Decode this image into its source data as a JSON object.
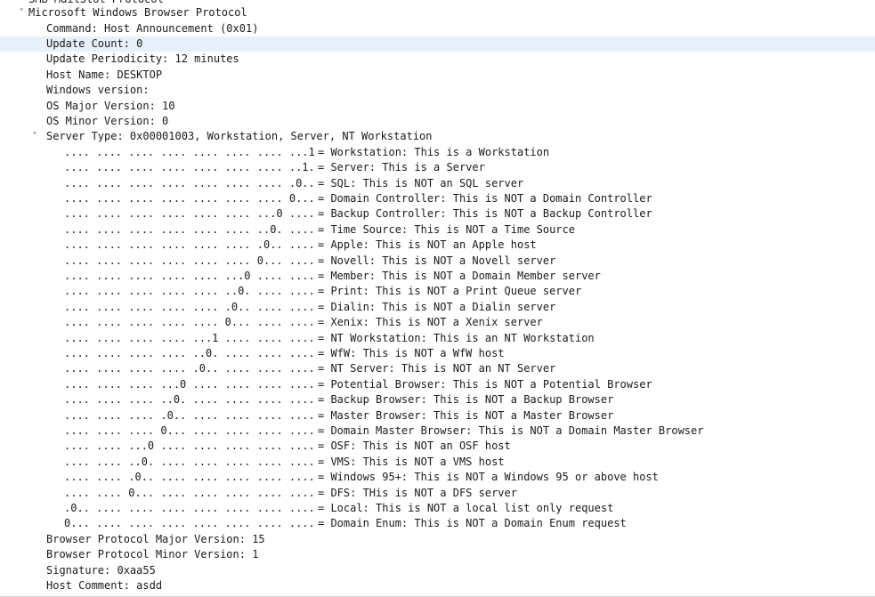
{
  "tree": {
    "cut_row": "SMB MailSlot Protocol",
    "protocol_label": "Microsoft Windows Browser Protocol",
    "toggle_glyph": "˅",
    "top_fields": [
      "Command: Host Announcement (0x01)",
      "Update Count: 0",
      "Update Periodicity: 12 minutes",
      "Host Name: DESKTOP",
      "Windows version:",
      "OS Major Version: 10",
      "OS Minor Version: 0"
    ],
    "selected_field": "Update Count: 0",
    "server_type_label": "Server Type: 0x00001003, Workstation, Server, NT Workstation",
    "server_type_bits": [
      {
        "bits": ".... .... .... .... .... .... .... ...1",
        "desc": "= Workstation: This is a Workstation"
      },
      {
        "bits": ".... .... .... .... .... .... .... ..1.",
        "desc": "= Server: This is a Server"
      },
      {
        "bits": ".... .... .... .... .... .... .... .0..",
        "desc": "= SQL: This is NOT an SQL server"
      },
      {
        "bits": ".... .... .... .... .... .... .... 0...",
        "desc": "= Domain Controller: This is NOT a Domain Controller"
      },
      {
        "bits": ".... .... .... .... .... .... ...0 ....",
        "desc": "= Backup Controller: This is NOT a Backup Controller"
      },
      {
        "bits": ".... .... .... .... .... .... ..0. ....",
        "desc": "= Time Source: This is NOT a Time Source"
      },
      {
        "bits": ".... .... .... .... .... .... .0.. ....",
        "desc": "= Apple: This is NOT an Apple host"
      },
      {
        "bits": ".... .... .... .... .... .... 0... ....",
        "desc": "= Novell: This is NOT a Novell server"
      },
      {
        "bits": ".... .... .... .... .... ...0 .... ....",
        "desc": "= Member: This is NOT a Domain Member server"
      },
      {
        "bits": ".... .... .... .... .... ..0. .... ....",
        "desc": "= Print: This is NOT a Print Queue server"
      },
      {
        "bits": ".... .... .... .... .... .0.. .... ....",
        "desc": "= Dialin: This is NOT a Dialin server"
      },
      {
        "bits": ".... .... .... .... .... 0... .... ....",
        "desc": "= Xenix: This is NOT a Xenix server"
      },
      {
        "bits": ".... .... .... .... ...1 .... .... ....",
        "desc": "= NT Workstation: This is an NT Workstation"
      },
      {
        "bits": ".... .... .... .... ..0. .... .... ....",
        "desc": "= WfW: This is NOT a WfW host"
      },
      {
        "bits": ".... .... .... .... .0.. .... .... ....",
        "desc": "= NT Server: This is NOT an NT Server"
      },
      {
        "bits": ".... .... .... ...0 .... .... .... ....",
        "desc": "= Potential Browser: This is NOT a Potential Browser"
      },
      {
        "bits": ".... .... .... ..0. .... .... .... ....",
        "desc": "= Backup Browser: This is NOT a Backup Browser"
      },
      {
        "bits": ".... .... .... .0.. .... .... .... ....",
        "desc": "= Master Browser: This is NOT a Master Browser"
      },
      {
        "bits": ".... .... .... 0... .... .... .... ....",
        "desc": "= Domain Master Browser: This is NOT a Domain Master Browser"
      },
      {
        "bits": ".... .... ...0 .... .... .... .... ....",
        "desc": "= OSF: This is NOT an OSF host"
      },
      {
        "bits": ".... .... ..0. .... .... .... .... ....",
        "desc": "= VMS: This is NOT a VMS host"
      },
      {
        "bits": ".... .... .0.. .... .... .... .... ....",
        "desc": "= Windows 95+: This is NOT a Windows 95 or above host"
      },
      {
        "bits": ".... .... 0... .... .... .... .... ....",
        "desc": "= DFS: THis is NOT a DFS server"
      },
      {
        "bits": ".0.. .... .... .... .... .... .... ....",
        "desc": "= Local: This is NOT a local list only request"
      },
      {
        "bits": "0... .... .... .... .... .... .... ....",
        "desc": "= Domain Enum: This is NOT a Domain Enum request"
      }
    ],
    "bottom_fields": [
      "Browser Protocol Major Version: 15",
      "Browser Protocol Minor Version: 1",
      "Signature: 0xaa55",
      "Host Comment: asdd"
    ]
  }
}
